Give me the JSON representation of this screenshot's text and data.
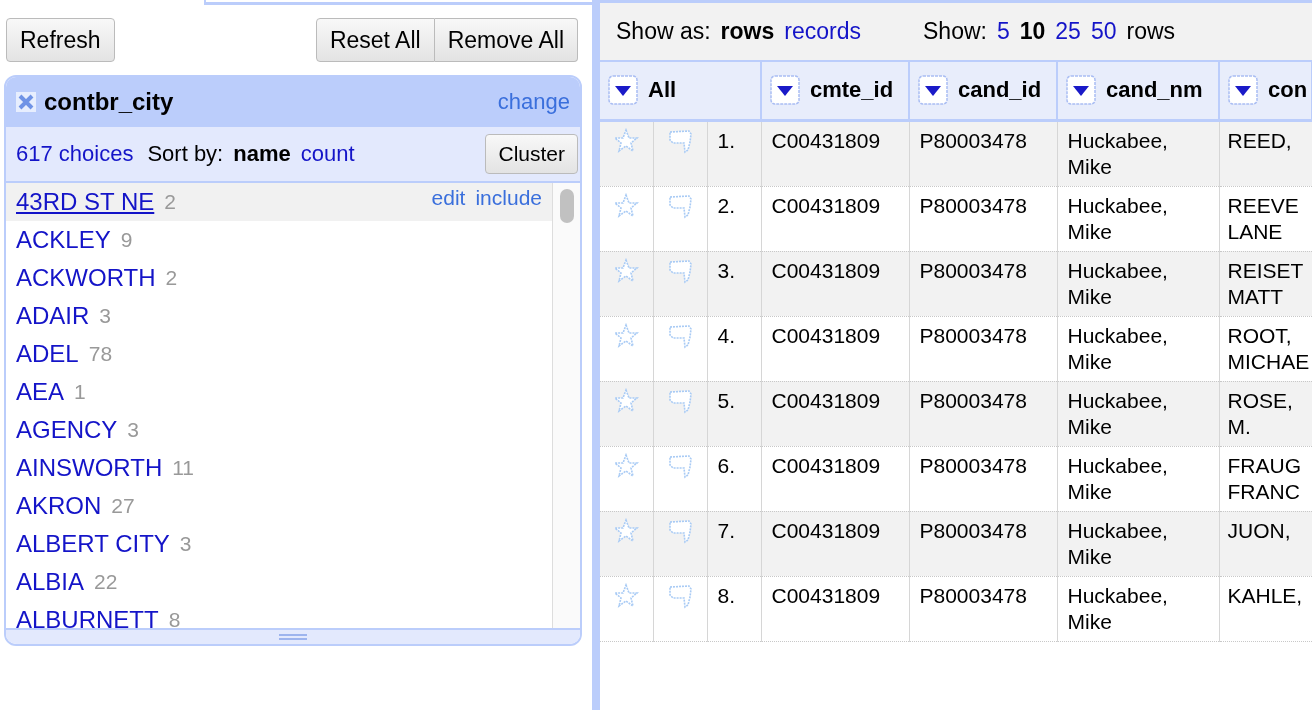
{
  "left_panel": {
    "buttons": [
      {
        "label": "Refresh"
      },
      {
        "label": "Reset All"
      },
      {
        "label": "Remove All"
      }
    ],
    "facet": {
      "title": "contbr_city",
      "change": "change",
      "choices_count": "617 choices",
      "sort_label": "Sort by:",
      "sort_options": [
        {
          "label": "name",
          "selected": true
        },
        {
          "label": "count",
          "selected": false
        }
      ],
      "cluster": "Cluster",
      "choices": [
        {
          "name": "43RD ST NE",
          "count": "2",
          "highlighted": true,
          "actions": [
            "edit",
            "include"
          ]
        },
        {
          "name": "ACKLEY",
          "count": "9",
          "highlighted": false
        },
        {
          "name": "ACKWORTH",
          "count": "2",
          "highlighted": false
        },
        {
          "name": "ADAIR",
          "count": "3",
          "highlighted": false
        },
        {
          "name": "ADEL",
          "count": "78",
          "highlighted": false
        },
        {
          "name": "AEA",
          "count": "1",
          "highlighted": false
        },
        {
          "name": "AGENCY",
          "count": "3",
          "highlighted": false
        },
        {
          "name": "AINSWORTH",
          "count": "11",
          "highlighted": false
        },
        {
          "name": "AKRON",
          "count": "27",
          "highlighted": false
        },
        {
          "name": "ALBERT CITY",
          "count": "3",
          "highlighted": false
        },
        {
          "name": "ALBIA",
          "count": "22",
          "highlighted": false
        },
        {
          "name": "ALBURNETT",
          "count": "8",
          "highlighted": false
        }
      ]
    }
  },
  "data_panel": {
    "show_as_label": "Show as:",
    "show_as": [
      {
        "label": "rows",
        "selected": true
      },
      {
        "label": "records",
        "selected": false
      }
    ],
    "show_label": "Show:",
    "page_sizes": [
      {
        "label": "5",
        "selected": false
      },
      {
        "label": "10",
        "selected": true
      },
      {
        "label": "25",
        "selected": false
      },
      {
        "label": "50",
        "selected": false
      }
    ],
    "show_suffix": "rows",
    "table": {
      "columns": [
        {
          "label": "All",
          "colspan": 3
        },
        {
          "label": "cmte_id"
        },
        {
          "label": "cand_id"
        },
        {
          "label": "cand_nm"
        },
        {
          "label": "con"
        }
      ],
      "rows": [
        {
          "cells": [
            "",
            "",
            "1.",
            "C00431809",
            "P80003478",
            "Huckabee, Mike",
            "REED,"
          ]
        },
        {
          "cells": [
            "",
            "",
            "2.",
            "C00431809",
            "P80003478",
            "Huckabee, Mike",
            "REEVE LANE"
          ]
        },
        {
          "cells": [
            "",
            "",
            "3.",
            "C00431809",
            "P80003478",
            "Huckabee, Mike",
            "REISET MATT"
          ]
        },
        {
          "cells": [
            "",
            "",
            "4.",
            "C00431809",
            "P80003478",
            "Huckabee, Mike",
            "ROOT, MICHAE"
          ]
        },
        {
          "cells": [
            "",
            "",
            "5.",
            "C00431809",
            "P80003478",
            "Huckabee, Mike",
            "ROSE, M."
          ]
        },
        {
          "cells": [
            "",
            "",
            "6.",
            "C00431809",
            "P80003478",
            "Huckabee, Mike",
            "FRAUG FRANC"
          ]
        },
        {
          "cells": [
            "",
            "",
            "7.",
            "C00431809",
            "P80003478",
            "Huckabee, Mike",
            "JUON,"
          ]
        },
        {
          "cells": [
            "",
            "",
            "8.",
            "C00431809",
            "P80003478",
            "Huckabee, Mike",
            "KAHLE,"
          ]
        }
      ]
    }
  }
}
